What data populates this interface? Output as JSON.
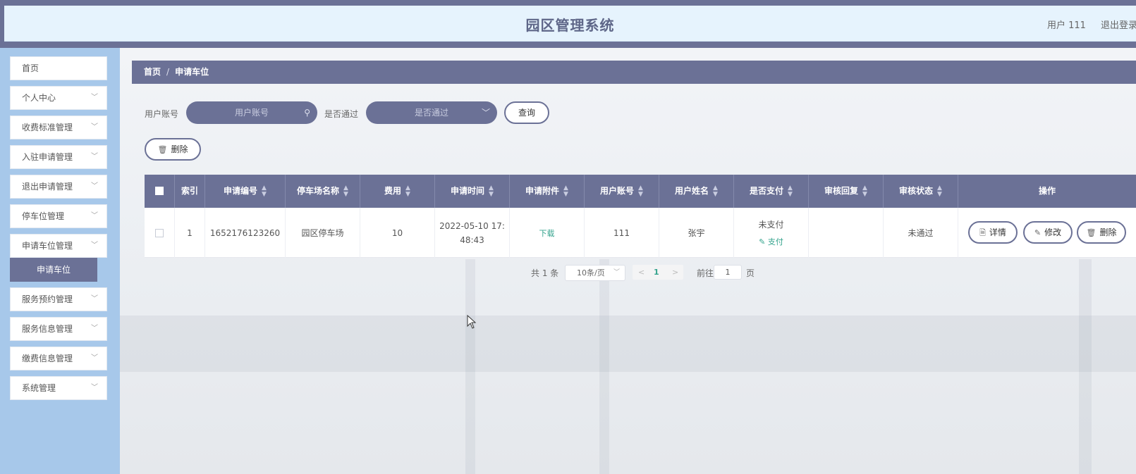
{
  "header": {
    "title": "园区管理系统",
    "user": "用户 111",
    "logout": "退出登录"
  },
  "sidebar": {
    "items": [
      {
        "label": "首页"
      },
      {
        "label": "个人中心"
      },
      {
        "label": "收费标准管理"
      },
      {
        "label": "入驻申请管理"
      },
      {
        "label": "退出申请管理"
      },
      {
        "label": "停车位管理"
      },
      {
        "label": "申请车位管理"
      },
      {
        "label": "服务预约管理"
      },
      {
        "label": "服务信息管理"
      },
      {
        "label": "缴费信息管理"
      },
      {
        "label": "系统管理"
      }
    ],
    "active_sub": "申请车位"
  },
  "breadcrumb": {
    "home": "首页",
    "sep": "/",
    "current": "申请车位"
  },
  "search": {
    "account_label": "用户账号",
    "account_placeholder": "用户账号",
    "pass_label": "是否通过",
    "pass_placeholder": "是否通过",
    "query_button": "查询",
    "delete_button": "删除"
  },
  "table": {
    "headers": [
      "索引",
      "申请编号",
      "停车场名称",
      "费用",
      "申请时间",
      "申请附件",
      "用户账号",
      "用户姓名",
      "是否支付",
      "审核回复",
      "审核状态",
      "操作"
    ],
    "rows": [
      {
        "index": "1",
        "apply_no": "1652176123260",
        "parking_name": "园区停车场",
        "fee": "10",
        "apply_time_1": "2022-05-10 17:",
        "apply_time_2": "48:43",
        "attachment": "下载",
        "account": "111",
        "name": "张宇",
        "paid": "未支付",
        "pay_action": "支付",
        "reply": "",
        "status": "未通过",
        "actions": {
          "detail": "详情",
          "edit": "修改",
          "delete": "删除"
        }
      }
    ]
  },
  "pagination": {
    "total": "共 1 条",
    "page_size": "10条/页",
    "current_page": "1",
    "goto_prefix": "前往",
    "goto_value": "1",
    "goto_suffix": "页"
  },
  "colors": {
    "primary": "#6b7196",
    "header_bg": "#e6f3fd",
    "sidebar_bg": "#a7c8ea",
    "link_green": "#34a38d"
  }
}
